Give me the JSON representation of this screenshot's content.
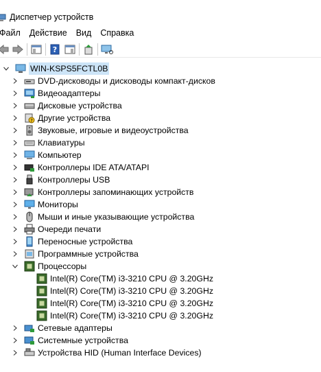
{
  "window": {
    "title": "Диспетчер устройств"
  },
  "menu": [
    {
      "label": "Файл"
    },
    {
      "label": "Действие"
    },
    {
      "label": "Вид"
    },
    {
      "label": "Справка"
    }
  ],
  "tree": {
    "root": "WIN-KSPS5FCTL0B",
    "categories": [
      {
        "label": "DVD-дисководы и дисководы компакт-дисков",
        "icon": "dvd-drive-icon"
      },
      {
        "label": "Видеоадаптеры",
        "icon": "display-adapter-icon"
      },
      {
        "label": "Дисковые устройства",
        "icon": "disk-drive-icon"
      },
      {
        "label": "Другие устройства",
        "icon": "unknown-device-icon"
      },
      {
        "label": "Звуковые, игровые и видеоустройства",
        "icon": "speaker-icon"
      },
      {
        "label": "Клавиатуры",
        "icon": "keyboard-icon"
      },
      {
        "label": "Компьютер",
        "icon": "computer-icon"
      },
      {
        "label": "Контроллеры IDE ATA/ATAPI",
        "icon": "ide-controller-icon"
      },
      {
        "label": "Контроллеры USB",
        "icon": "usb-icon"
      },
      {
        "label": "Контроллеры запоминающих устройств",
        "icon": "storage-controller-icon"
      },
      {
        "label": "Мониторы",
        "icon": "monitor-icon"
      },
      {
        "label": "Мыши и иные указывающие устройства",
        "icon": "mouse-icon"
      },
      {
        "label": "Очереди печати",
        "icon": "printer-icon"
      },
      {
        "label": "Переносные устройства",
        "icon": "portable-device-icon"
      },
      {
        "label": "Программные устройства",
        "icon": "software-device-icon"
      },
      {
        "label": "Процессоры",
        "icon": "processor-icon",
        "expanded": true,
        "children": [
          "Intel(R) Core(TM) i3-3210 CPU @ 3.20GHz",
          "Intel(R) Core(TM) i3-3210 CPU @ 3.20GHz",
          "Intel(R) Core(TM) i3-3210 CPU @ 3.20GHz",
          "Intel(R) Core(TM) i3-3210 CPU @ 3.20GHz"
        ]
      },
      {
        "label": "Сетевые адаптеры",
        "icon": "network-adapter-icon"
      },
      {
        "label": "Системные устройства",
        "icon": "system-device-icon"
      },
      {
        "label": "Устройства HID (Human Interface Devices)",
        "icon": "hid-icon"
      }
    ]
  },
  "colors": {
    "selection": "#cce4f7",
    "accent": "#2b78c5"
  }
}
